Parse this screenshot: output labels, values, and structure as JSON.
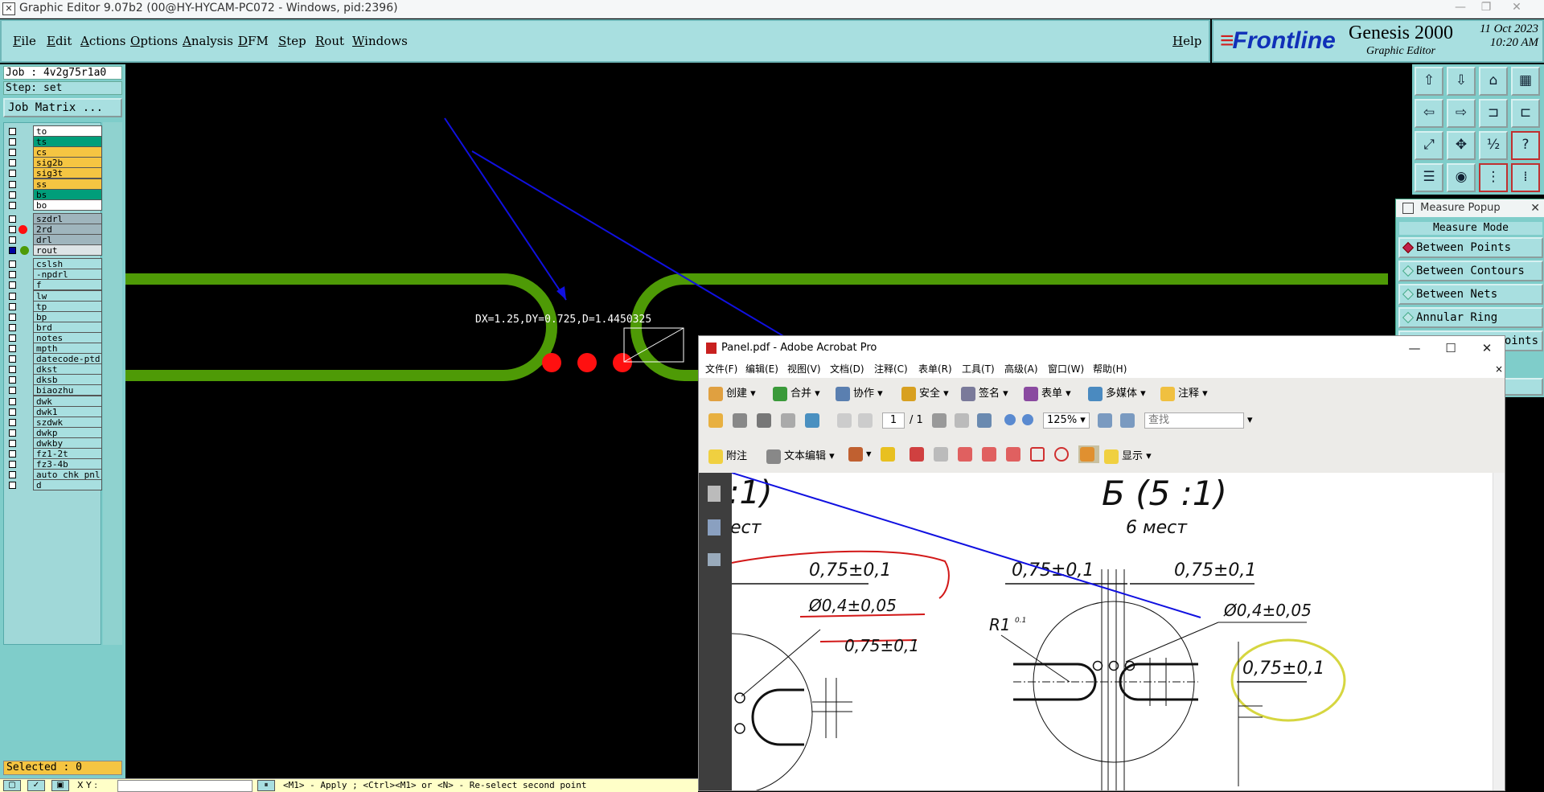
{
  "app_window": {
    "title": "Graphic Editor 9.07b2 (00@HY-HYCAM-PC072 - Windows, pid:2396)",
    "window_controls": [
      "—",
      "❐",
      "✕"
    ]
  },
  "menu": {
    "items": [
      "File",
      "Edit",
      "Actions",
      "Options",
      "Analysis",
      "DFM",
      "Step",
      "Rout",
      "Windows"
    ],
    "help": "Help"
  },
  "brand": {
    "logo": "Frontline",
    "product": "Genesis 2000",
    "module": "Graphic Editor",
    "date": "11 Oct 2023",
    "time": "10:20 AM"
  },
  "left_panel": {
    "job": "Job : 4v2g75r1a0",
    "step": "Step: set",
    "job_matrix": "Job Matrix ...",
    "layers": [
      {
        "name": "to",
        "color": "#ffffff"
      },
      {
        "name": "ts",
        "color": "#009e7a"
      },
      {
        "name": "cs",
        "color": "#f5c542"
      },
      {
        "name": "sig2b",
        "color": "#f5c542"
      },
      {
        "name": "sig3t",
        "color": "#f5c542"
      },
      {
        "name": "ss",
        "color": "#f5c542"
      },
      {
        "name": "bs",
        "color": "#009e7a"
      },
      {
        "name": "bo",
        "color": "#ffffff"
      },
      {
        "name": "szdrl",
        "color": "#9fb5bd"
      },
      {
        "name": "2rd",
        "color": "#9fb5bd"
      },
      {
        "name": "drl",
        "color": "#9fb5bd"
      },
      {
        "name": "rout",
        "color": "#dde4e6"
      },
      {
        "name": "cslsh",
        "color": "#a8dfe0"
      },
      {
        "name": "-npdrl",
        "color": "#a8dfe0"
      },
      {
        "name": "f",
        "color": "#a8dfe0"
      },
      {
        "name": "lw",
        "color": "#a8dfe0"
      },
      {
        "name": "tp",
        "color": "#a8dfe0"
      },
      {
        "name": "bp",
        "color": "#a8dfe0"
      },
      {
        "name": "brd",
        "color": "#a8dfe0"
      },
      {
        "name": "notes",
        "color": "#a8dfe0"
      },
      {
        "name": "mpth",
        "color": "#a8dfe0"
      },
      {
        "name": "datecode-ptd",
        "color": "#a8dfe0"
      },
      {
        "name": "dkst",
        "color": "#a8dfe0"
      },
      {
        "name": "dksb",
        "color": "#a8dfe0"
      },
      {
        "name": "biaozhu",
        "color": "#a8dfe0"
      },
      {
        "name": "dwk",
        "color": "#a8dfe0"
      },
      {
        "name": "dwk1",
        "color": "#a8dfe0"
      },
      {
        "name": "szdwk",
        "color": "#a8dfe0"
      },
      {
        "name": "dwkp",
        "color": "#a8dfe0"
      },
      {
        "name": "dwkby",
        "color": "#a8dfe0"
      },
      {
        "name": "fz1-2t",
        "color": "#a8dfe0"
      },
      {
        "name": "fz3-4b",
        "color": "#a8dfe0"
      },
      {
        "name": "auto_chk_pnl",
        "color": "#a8dfe0"
      },
      {
        "name": "d",
        "color": "#a8dfe0"
      }
    ],
    "selected": "Selected : 0"
  },
  "canvas": {
    "measure_text": "DX=1.25,DY=0.725,D=1.4450325"
  },
  "measure_popup": {
    "title": "Measure Popup",
    "mode_label": "Measure Mode",
    "options": [
      "Between Points",
      "Between Contours",
      "Between Nets",
      "Annular Ring",
      "points"
    ],
    "selected_index": 0
  },
  "status": {
    "hint": "<M1> - Apply  ; <Ctrl><M1> or <N> - Re-select second point",
    "xy_label": "X Y :"
  },
  "acrobat": {
    "title": "Panel.pdf - Adobe Acrobat Pro",
    "menu": [
      "文件(F)",
      "编辑(E)",
      "视图(V)",
      "文档(D)",
      "注释(C)",
      "表单(R)",
      "工具(T)",
      "高级(A)",
      "窗口(W)",
      "帮助(H)"
    ],
    "toolbar1": [
      "创建",
      "合并",
      "协作",
      "安全",
      "签名",
      "表单",
      "多媒体",
      "注释"
    ],
    "page_current": "1",
    "page_total": "/ 1",
    "zoom": "125%",
    "search_placeholder": "查找",
    "toolbar3": {
      "attach": "附注",
      "text_edit": "文本编辑",
      "show": "显示"
    },
    "drawing": {
      "scale_left": ":1)",
      "scale_right": "Б (5 :1)",
      "places_left": "ест",
      "places_right": "6 мест",
      "dim_1": "0,75±0,1",
      "dim_2": "Ø0,4±0,05",
      "dim_3": "0,75±0,1",
      "dim_4": "0,75±0,1",
      "dim_5": "0,75±0,1",
      "dim_6": "Ø0,4±0,05",
      "dim_7": "0,75±0,1",
      "radius": "R1",
      "radius_sup": "0.1"
    }
  },
  "colors": {
    "copper_green": "#4e9a06",
    "drill_red": "#ff1010",
    "arrow_blue": "#1010e0",
    "panel_cyan": "#a8dfe0"
  }
}
